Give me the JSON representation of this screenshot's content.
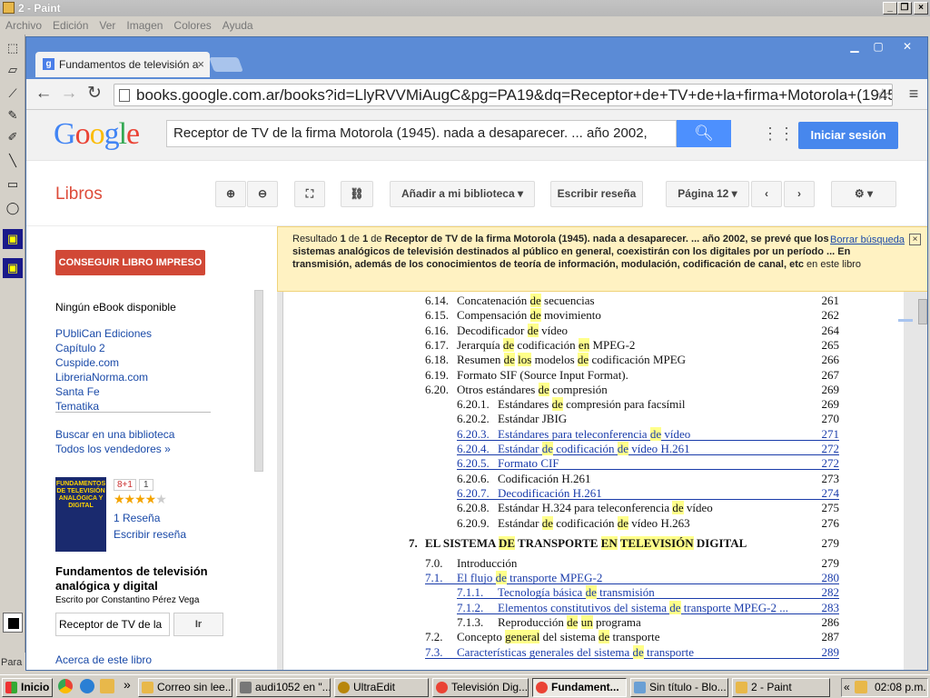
{
  "paint": {
    "title": "2 - Paint",
    "menu": [
      "Archivo",
      "Edición",
      "Ver",
      "Imagen",
      "Colores",
      "Ayuda"
    ],
    "status": "Para"
  },
  "chrome": {
    "tab_title": "Fundamentos de televisión a",
    "url": "books.google.com.ar/books?id=LlyRVVMiAugC&pg=PA19&dq=Receptor+de+TV+de+la+firma+Motorola+(1945"
  },
  "google": {
    "logo": "Google",
    "search_value": "Receptor de TV de la firma Motorola (1945). nada a desaparecer. ... año 2002,",
    "signin": "Iniciar sesión"
  },
  "books_bar": {
    "section": "Libros",
    "add_library": "Añadir a mi biblioteca",
    "write_review": "Escribir reseña",
    "page_label": "Página 12"
  },
  "sidebar": {
    "buy": "CONSEGUIR LIBRO IMPRESO",
    "no_ebook": "Ningún eBook disponible",
    "sellers": [
      "PUbliCan Ediciones",
      "Capítulo 2",
      "Cuspide.com",
      "LibreriaNorma.com",
      "Santa Fe",
      "Tematika"
    ],
    "find_library": "Buscar en una biblioteca",
    "all_sellers": "Todos los vendedores »",
    "cover_text": "FUNDAMENTOS DE TELEVISIÓN ANALÓGICA Y DIGITAL",
    "gplus": "8+1",
    "gcount": "1",
    "rating": 4,
    "reviews": "1 Reseña",
    "write_review": "Escribir reseña",
    "book_title": "Fundamentos de televisión analógica y digital",
    "author": "Escrito por Constantino Pérez Vega",
    "search_value": "Receptor de TV de la",
    "go": "Ir",
    "about": "Acerca de este libro"
  },
  "banner": {
    "prefix": "Resultado ",
    "n": "1",
    "of": " de ",
    "total": "1",
    "de": " de ",
    "query": "Receptor de TV de la firma Motorola (1945). nada a desaparecer. ... año 2002, se prevé que los sistemas analógicos de televisión destinados al público en general, coexistirán con los digitales por un período ... En transmisión, además de los conocimientos de teoría de información, modulación, codificación de canal, etc",
    "suffix": " en este libro",
    "clear": "Borrar búsqueda"
  },
  "toc": [
    {
      "num": "6.14.",
      "title": "Concatenación de secuencias",
      "page": "261",
      "indent": 1,
      "link": false
    },
    {
      "num": "6.15.",
      "title": "Compensación de movimiento",
      "page": "262",
      "indent": 1,
      "link": false
    },
    {
      "num": "6.16.",
      "title": "Decodificador de vídeo",
      "page": "264",
      "indent": 1,
      "link": false
    },
    {
      "num": "6.17.",
      "title": "Jerarquía de codificación en MPEG-2",
      "page": "265",
      "indent": 1,
      "link": false
    },
    {
      "num": "6.18.",
      "title": "Resumen de los modelos de codificación MPEG",
      "page": "266",
      "indent": 1,
      "link": false
    },
    {
      "num": "6.19.",
      "title": "Formato SIF (Source Input Format).",
      "page": "267",
      "indent": 1,
      "link": false
    },
    {
      "num": "6.20.",
      "title": "Otros estándares de compresión",
      "page": "269",
      "indent": 1,
      "link": false
    },
    {
      "num": "6.20.1.",
      "title": "Estándares de compresión para facsímil",
      "page": "269",
      "indent": 2,
      "link": false
    },
    {
      "num": "6.20.2.",
      "title": "Estándar JBIG",
      "page": "270",
      "indent": 2,
      "link": false
    },
    {
      "num": "6.20.3.",
      "title": "Estándares para teleconferencia de vídeo",
      "page": "271",
      "indent": 2,
      "link": true
    },
    {
      "num": "6.20.4.",
      "title": "Estándar de codificación de vídeo H.261",
      "page": "272",
      "indent": 2,
      "link": true
    },
    {
      "num": "6.20.5.",
      "title": "Formato CIF",
      "page": "272",
      "indent": 2,
      "link": true
    },
    {
      "num": "6.20.6.",
      "title": "Codificación H.261",
      "page": "273",
      "indent": 2,
      "link": false
    },
    {
      "num": "6.20.7.",
      "title": "Decodificación H.261",
      "page": "274",
      "indent": 2,
      "link": true
    },
    {
      "num": "6.20.8.",
      "title": "Estándar H.324 para teleconferencia de vídeo",
      "page": "275",
      "indent": 2,
      "link": false
    },
    {
      "num": "6.20.9.",
      "title": "Estándar de codificación de vídeo H.263",
      "page": "276",
      "indent": 2,
      "link": false
    },
    {
      "num": "7.",
      "title": "EL SISTEMA DE TRANSPORTE EN TELEVISIÓN DIGITAL",
      "page": "279",
      "indent": 0,
      "link": false
    },
    {
      "num": "7.0.",
      "title": "Introducción",
      "page": "279",
      "indent": 1,
      "link": false
    },
    {
      "num": "7.1.",
      "title": "El flujo de transporte MPEG-2",
      "page": "280",
      "indent": 1,
      "link": true
    },
    {
      "num": "7.1.1.",
      "title": "Tecnología básica de transmisión",
      "page": "282",
      "indent": 2,
      "link": true
    },
    {
      "num": "7.1.2.",
      "title": "Elementos constitutivos del sistema de transporte MPEG-2 ...",
      "page": "283",
      "indent": 2,
      "link": true
    },
    {
      "num": "7.1.3.",
      "title": "Reproducción de un programa",
      "page": "286",
      "indent": 2,
      "link": false
    },
    {
      "num": "7.2.",
      "title": "Concepto general del sistema de transporte",
      "page": "287",
      "indent": 1,
      "link": false
    },
    {
      "num": "7.3.",
      "title": "Características generales del sistema de transporte",
      "page": "289",
      "indent": 1,
      "link": true
    }
  ],
  "taskbar": {
    "start": "Inicio",
    "tasks": [
      "Correo sin lee...",
      "audi1052 en \"...",
      "UltraEdit",
      "Televisión Dig...",
      "Fundament...",
      "Sin título - Blo...",
      "2 - Paint"
    ],
    "active": 4,
    "clock": "02:08 p.m."
  },
  "colors": {
    "accent": "#4d90fe",
    "buy": "#d14836",
    "libros": "#dd4b39",
    "banner": "#fff2c2",
    "link": "#1a4aa8"
  }
}
